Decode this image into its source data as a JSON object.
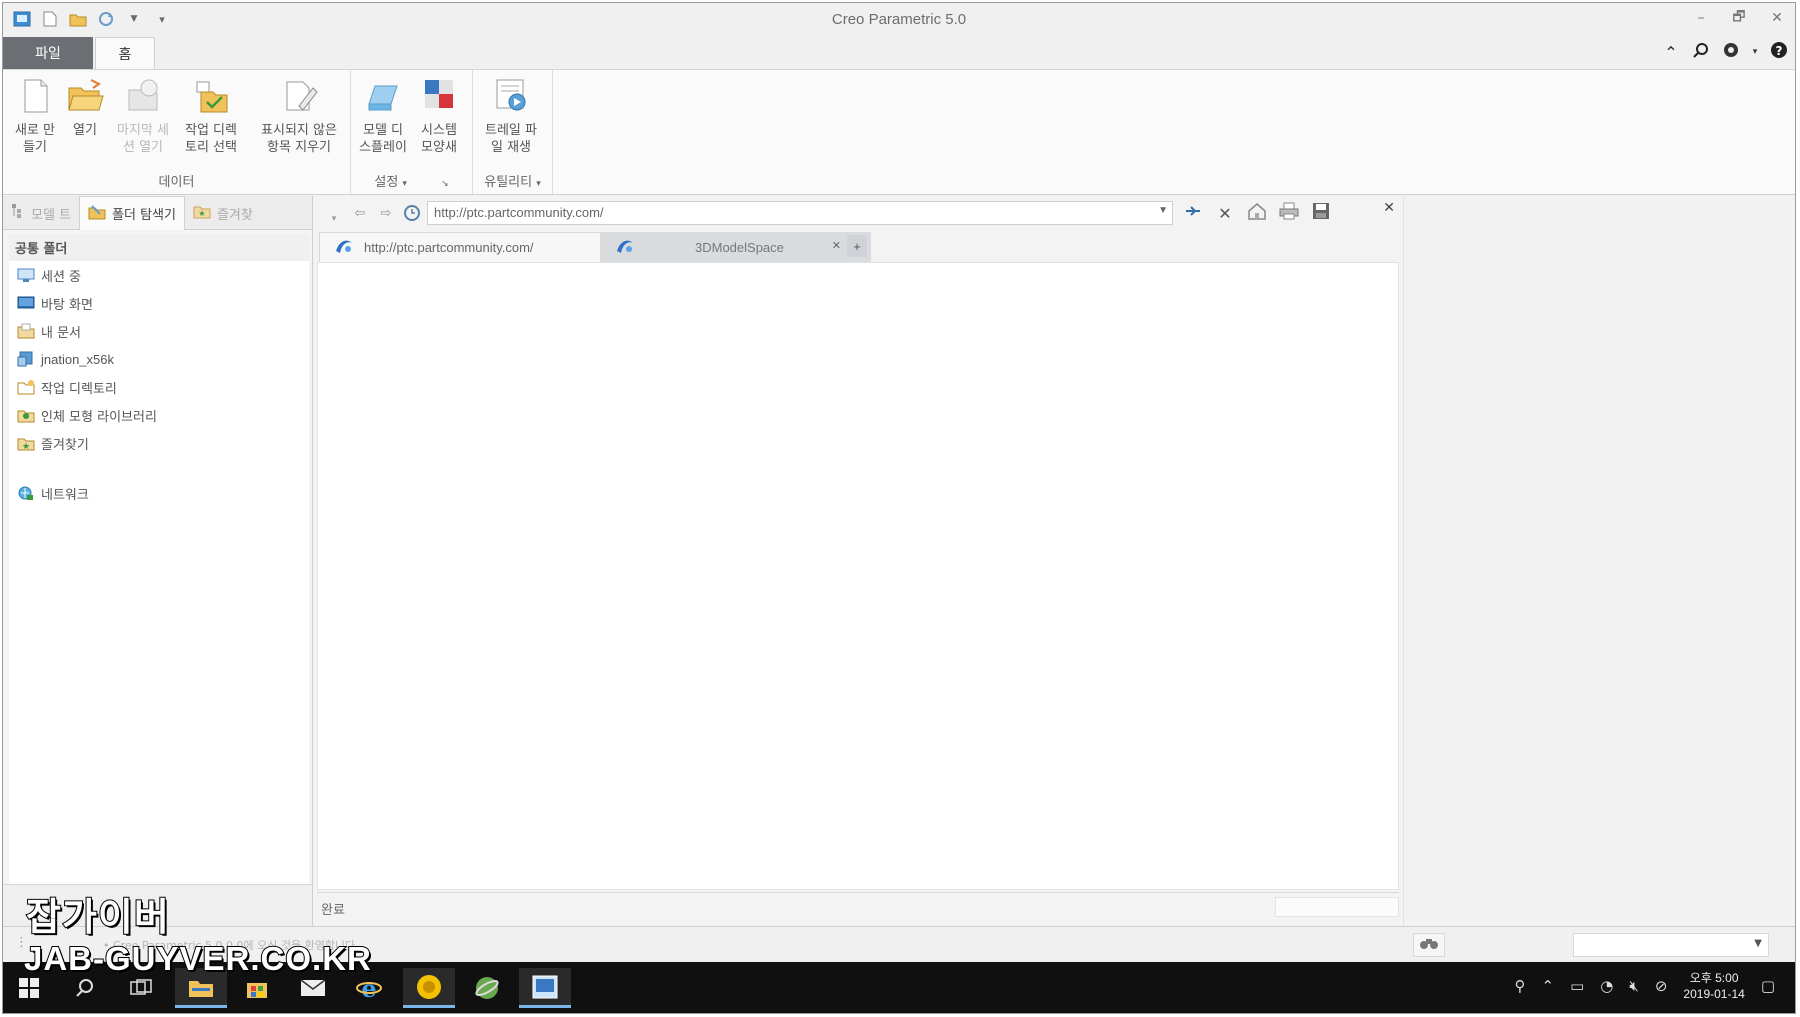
{
  "app": {
    "title": "Creo Parametric 5.0"
  },
  "quick_access": {
    "icons": [
      "new-file-icon",
      "open-folder-icon",
      "regenerate-icon",
      "dropdown-arrow-icon",
      "customize-arrow-icon"
    ]
  },
  "window_controls": {
    "minimize": "–",
    "restore": "🗗",
    "close": "✕"
  },
  "ribbon_tabs": {
    "file": "파일",
    "home": "홈"
  },
  "ribbon_right_icons": [
    "collapse-ribbon-icon",
    "search-icon",
    "settings-icon",
    "help-icon"
  ],
  "ribbon": {
    "groups": [
      {
        "label": "데이터",
        "buttons": [
          {
            "label_line1": "새로 만",
            "label_line2": "들기",
            "icon": "new-icon",
            "enabled": true
          },
          {
            "label_line1": "열기",
            "label_line2": "",
            "icon": "open-icon",
            "enabled": true
          },
          {
            "label_line1": "마지막 세",
            "label_line2": "션 열기",
            "icon": "open-last-session-icon",
            "enabled": false
          },
          {
            "label_line1": "작업 디렉",
            "label_line2": "토리 선택",
            "icon": "select-working-dir-icon",
            "enabled": true
          },
          {
            "label_line1": "표시되지 않은",
            "label_line2": "항목 지우기",
            "icon": "erase-not-displayed-icon",
            "enabled": true
          }
        ]
      },
      {
        "label": "설정",
        "buttons": [
          {
            "label_line1": "모델 디",
            "label_line2": "스플레이",
            "icon": "model-display-icon",
            "enabled": true
          },
          {
            "label_line1": "시스템",
            "label_line2": "모양새",
            "icon": "system-appearance-icon",
            "enabled": true
          }
        ]
      },
      {
        "label": "유틸리티",
        "buttons": [
          {
            "label_line1": "트레일 파",
            "label_line2": "일 재생",
            "icon": "play-trail-file-icon",
            "enabled": true
          }
        ]
      }
    ]
  },
  "left_panel": {
    "tabs": [
      {
        "label": "모델 트",
        "icon": "model-tree-icon",
        "active": false
      },
      {
        "label": "폴더 탐색기",
        "icon": "folder-browser-icon",
        "active": true
      },
      {
        "label": "즐겨찾",
        "icon": "favorites-icon",
        "active": false
      }
    ],
    "header": "공통 폴더",
    "items": [
      {
        "label": "세션 중",
        "icon": "in-session-icon"
      },
      {
        "label": "바탕 화면",
        "icon": "desktop-icon"
      },
      {
        "label": "내 문서",
        "icon": "documents-icon"
      },
      {
        "label": "jnation_x56k",
        "icon": "user-folder-icon"
      },
      {
        "label": "작업 디렉토리",
        "icon": "working-directory-icon"
      },
      {
        "label": "인체 모형 라이브러리",
        "icon": "manikin-library-icon"
      },
      {
        "label": "즐겨찾기",
        "icon": "favorites-folder-icon"
      }
    ],
    "network": {
      "label": "네트워크",
      "icon": "network-icon"
    }
  },
  "browser": {
    "url": "http://ptc.partcommunity.com/",
    "tabs": [
      {
        "label": "http://ptc.partcommunity.com/",
        "icon": "partcommunity-icon",
        "active": true
      },
      {
        "label": "3DModelSpace",
        "icon": "partcommunity-icon",
        "active": false
      }
    ],
    "new_tab": "+",
    "tab_close": "✕",
    "status": "완료",
    "close_panel": "✕"
  },
  "message_area": {
    "text": "• Creo Parametric 5.0.0.0에 오신 것을 환영합니다.",
    "find_icon": "binoculars-icon"
  },
  "taskbar": {
    "clock_line1": "오후 5:00",
    "clock_line2": "2019-01-14"
  },
  "watermark": {
    "line1": "잡가이버",
    "line2": "JAB-GUYVER.CO.KR"
  },
  "colors": {
    "file_tab": "#6b6f74",
    "ribbon_bg": "#fafafa",
    "taskbar": "#101010",
    "active_browser_tab": "#f7f7f7",
    "inactive_browser_tab": "#d9dcdf"
  }
}
